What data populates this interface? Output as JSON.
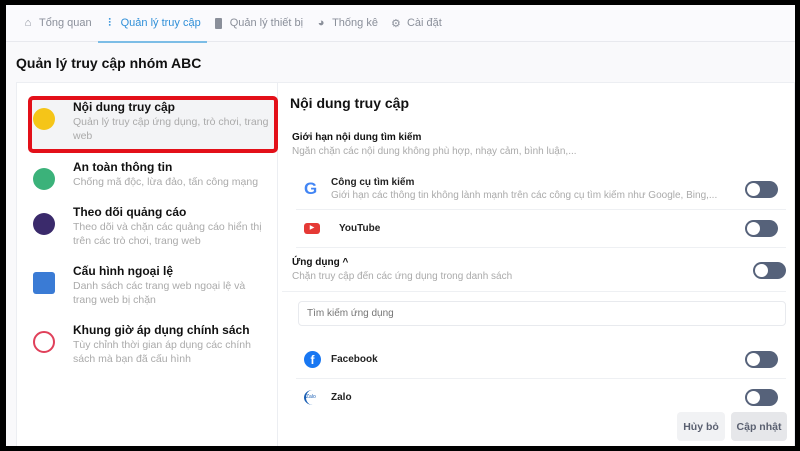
{
  "tabs": [
    {
      "label": "Tổng quan",
      "icon": "home-icon"
    },
    {
      "label": "Quản lý truy cập",
      "icon": "sliders-icon"
    },
    {
      "label": "Quản lý thiết bị",
      "icon": "phone-icon"
    },
    {
      "label": "Thống kê",
      "icon": "pie-chart-icon"
    },
    {
      "label": "Cài đặt",
      "icon": "gear-icon"
    }
  ],
  "page_title": "Quản lý truy cập nhóm ABC",
  "menu": [
    {
      "title": "Nội dung truy cập",
      "desc": "Quản lý truy cập ứng dụng, trò chơi, trang web",
      "color": "#f5c518"
    },
    {
      "title": "An toàn thông tin",
      "desc": "Chống mã độc, lừa đảo, tấn công mạng",
      "color": "#3bb27a"
    },
    {
      "title": "Theo dõi quảng cáo",
      "desc": "Theo dõi và chặn các quảng cáo hiển thị trên các trò chơi, trang web",
      "color": "#3a2a6b"
    },
    {
      "title": "Cấu hình ngoại lệ",
      "desc": "Danh sách các trang web ngoại lệ và trang web bị chặn",
      "color": "#3a7bd5"
    },
    {
      "title": "Khung giờ áp dụng chính sách",
      "desc": "Tùy chỉnh thời gian áp dụng các chính sách mà bạn đã cấu hình",
      "color": "#e0405a"
    }
  ],
  "panel": {
    "heading": "Nội dung truy cập",
    "search_section": {
      "title": "Giới hạn nội dung tìm kiếm",
      "desc": "Ngăn chặn các nội dung không phù hợp, nhạy cảm, bình luận,..."
    },
    "search_engines": {
      "title": "Công cụ tìm kiếm",
      "desc": "Giới hạn các thông tin không lành mạnh trên các công cụ tìm kiếm như Google, Bing,...",
      "on": false
    },
    "youtube": {
      "title": "YouTube",
      "on": false
    },
    "apps": {
      "title": "Ứng dụng ^",
      "desc": "Chặn truy cập đến các ứng dụng trong danh sách",
      "on": false
    },
    "app_search_placeholder": "Tìm kiếm ứng dụng",
    "facebook": {
      "title": "Facebook",
      "on": false
    },
    "zalo": {
      "title": "Zalo",
      "icon_text": "Zalo",
      "on": false
    },
    "cancel": "Hủy bỏ",
    "update": "Cập nhật"
  },
  "colors": {
    "accent": "#2f8fd8",
    "toggle": "#56627a",
    "highlight": "#e31019"
  }
}
